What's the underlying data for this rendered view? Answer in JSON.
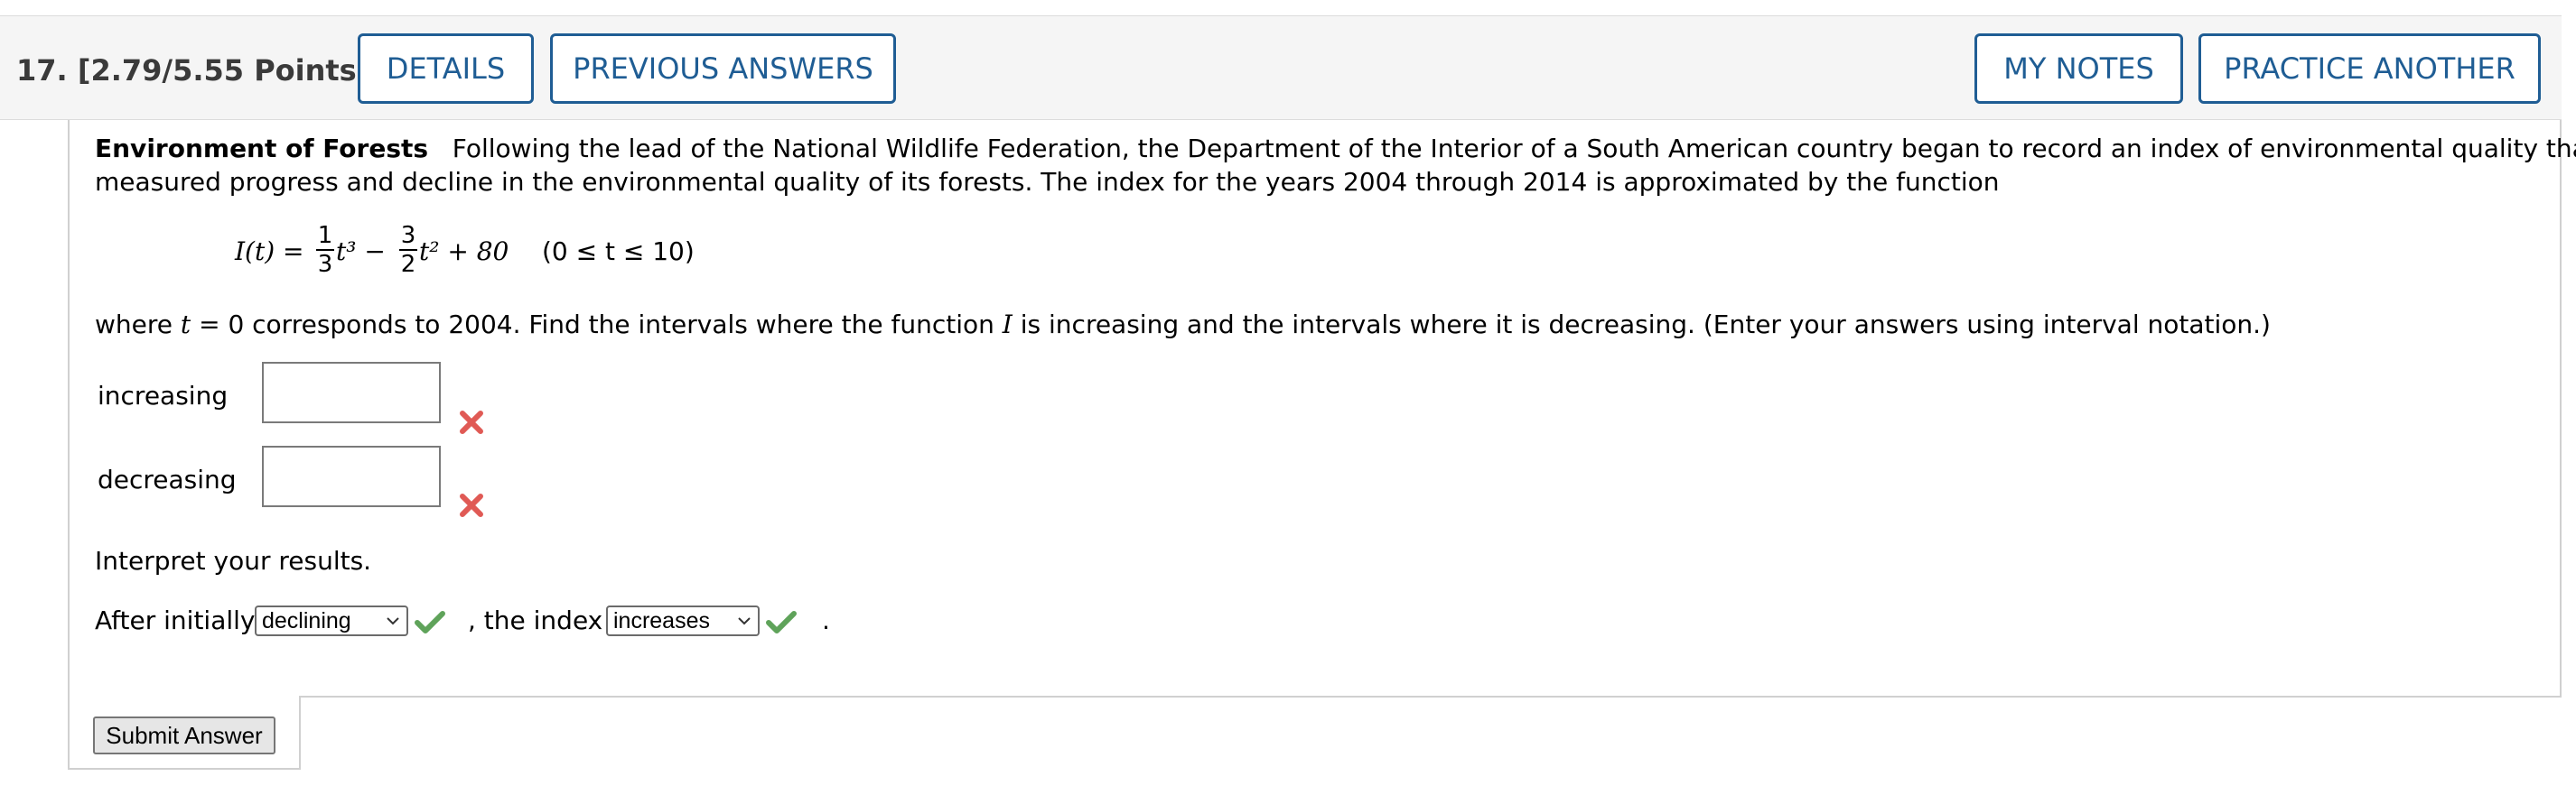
{
  "header": {
    "question_label": "17.  [2.79/5.55 Points]",
    "buttons": {
      "details": "DETAILS",
      "previous_answers": "PREVIOUS ANSWERS",
      "my_notes": "MY NOTES",
      "practice_another": "PRACTICE ANOTHER"
    }
  },
  "problem": {
    "title": "Environment of Forests",
    "intro_line1": "Following the lead of the National Wildlife Federation, the Department of the Interior of a South American country began to record an index of environmental quality that",
    "intro_line2": "measured progress and decline in the environmental quality of its forests. The index for the years 2004 through 2014 is approximated by the function",
    "formula": {
      "lhs": "I(t) =",
      "frac1_num": "1",
      "frac1_den": "3",
      "term1": "t³ −",
      "frac2_num": "3",
      "frac2_den": "2",
      "term2": "t² + 80",
      "domain": "(0 ≤ t ≤ 10)"
    },
    "question_part1": "where",
    "question_var": "t",
    "question_part2": "= 0 corresponds to 2004. Find the intervals where the function",
    "question_fn": "I",
    "question_part3": "is increasing and the intervals where it is decreasing. (Enter your answers using interval notation.)"
  },
  "answers": {
    "increasing_label": "increasing",
    "increasing_value": "",
    "increasing_status": "incorrect",
    "decreasing_label": "decreasing",
    "decreasing_value": "",
    "decreasing_status": "incorrect"
  },
  "interpret": {
    "prompt": "Interpret your results.",
    "sentence_start": "After initially",
    "select1_value": "declining",
    "select1_status": "correct",
    "sentence_mid": ", the index",
    "select2_value": "increases",
    "select2_status": "correct",
    "sentence_end": "."
  },
  "submit_label": "Submit Answer",
  "colors": {
    "button_blue": "#1f5d94",
    "incorrect_red": "#e05a55",
    "correct_green": "#5fa35a"
  },
  "icons": [
    "x-mark-icon",
    "check-mark-icon",
    "chevron-down-icon"
  ]
}
